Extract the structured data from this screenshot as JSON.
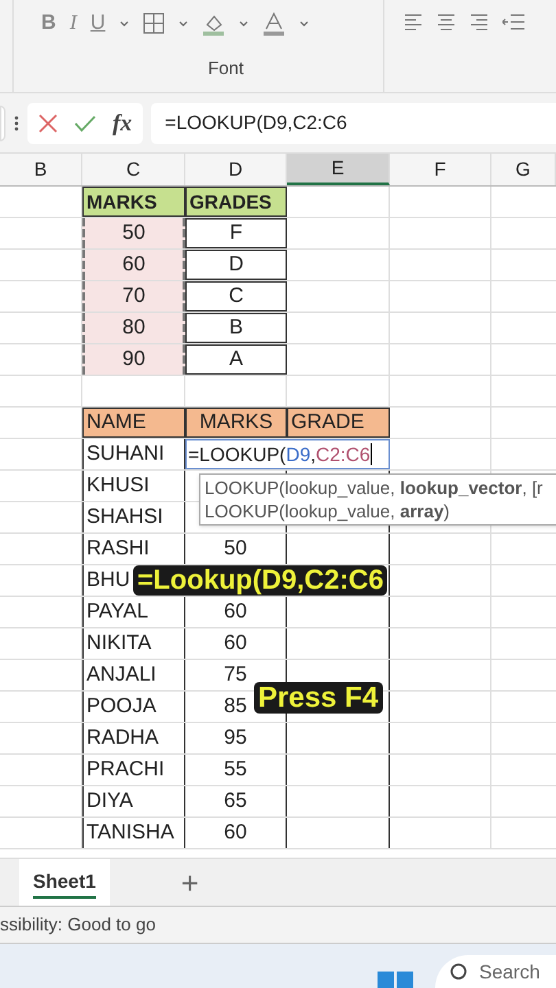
{
  "ribbon": {
    "font_buttons": [
      "B",
      "I",
      "U"
    ],
    "group_label": "Font"
  },
  "formula_bar": {
    "fx": "fx",
    "formula": "=LOOKUP(D9,C2:C6"
  },
  "column_headers": [
    {
      "label": "B",
      "selected": false
    },
    {
      "label": "C",
      "selected": false
    },
    {
      "label": "D",
      "selected": false
    },
    {
      "label": "E",
      "selected": true
    },
    {
      "label": "F",
      "selected": false
    },
    {
      "label": "G",
      "selected": false
    }
  ],
  "lookup_table": {
    "columns": [
      "MARKS",
      "GRADES"
    ],
    "rows": [
      [
        "50",
        "F"
      ],
      [
        "60",
        "D"
      ],
      [
        "70",
        "C"
      ],
      [
        "80",
        "B"
      ],
      [
        "90",
        "A"
      ]
    ]
  },
  "students_table": {
    "columns": [
      "NAME",
      "MARKS",
      "GRADE"
    ],
    "rows": [
      {
        "name": "SUHANI",
        "editing": true
      },
      {
        "name": "KHUSI",
        "editing": false
      },
      {
        "name": "SHAHSI",
        "editing": false
      },
      {
        "name": "RASHI",
        "marks": "50",
        "editing": false
      },
      {
        "name": "BHU",
        "editing": false
      },
      {
        "name": "PAYAL",
        "marks": "60",
        "editing": false
      },
      {
        "name": "NIKITA",
        "marks": "60",
        "editing": false
      },
      {
        "name": "ANJALI",
        "marks": "75",
        "editing": false
      },
      {
        "name": "POOJA",
        "marks": "85",
        "editing": false
      },
      {
        "name": "RADHA",
        "marks": "95",
        "editing": false
      },
      {
        "name": "PRACHI",
        "marks": "55",
        "editing": false
      },
      {
        "name": "DIYA",
        "marks": "65",
        "editing": false
      },
      {
        "name": "TANISHA",
        "marks": "60",
        "editing": false
      }
    ]
  },
  "editing_cell": {
    "function": "=LOOKUP(",
    "separator": ",",
    "arguments": [
      {
        "text": "D9",
        "color": "#3a6cc8"
      },
      {
        "text": "C2:C6",
        "color": "#b0506e"
      }
    ]
  },
  "tooltip": {
    "lines": [
      "LOOKUP(lookup_value, **lookup_vector**, [r",
      "LOOKUP(lookup_value, **array**)"
    ]
  },
  "captions": [
    "=Lookup(D9,C2:C6",
    "Press F4"
  ],
  "sheet_tabs": [
    {
      "label": "Sheet1",
      "selected": true
    }
  ],
  "add_sheet": "+",
  "status_bar": "ssibility: Good to go",
  "taskbar": {
    "search_placeholder": "Search"
  }
}
